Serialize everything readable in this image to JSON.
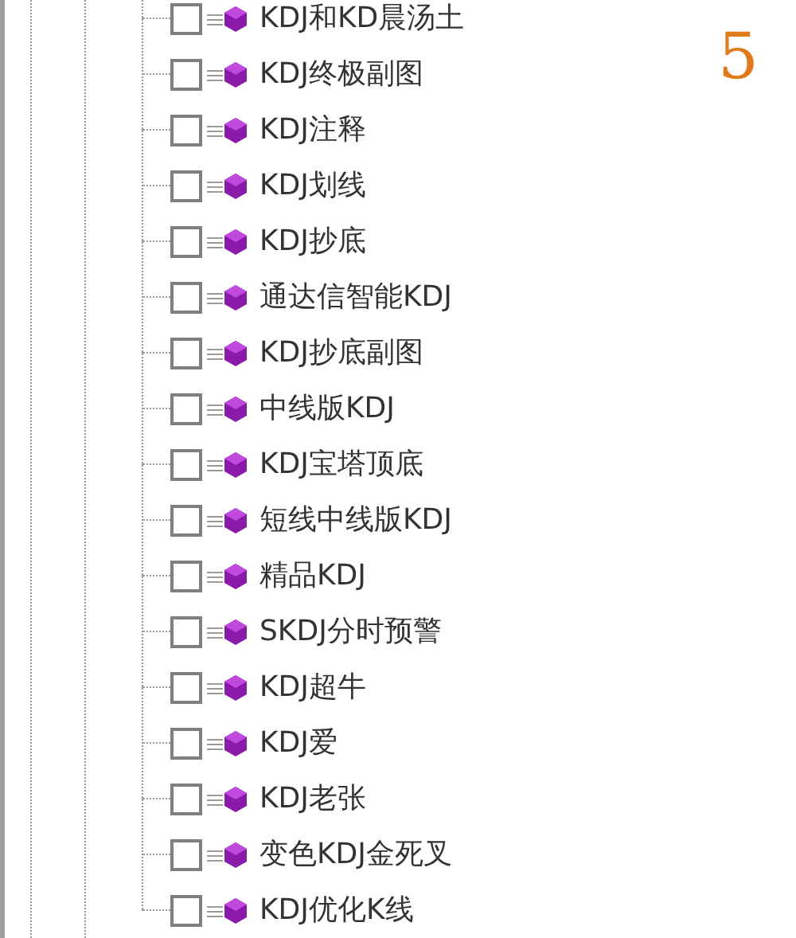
{
  "page_number": "5",
  "tree": {
    "items": [
      {
        "label": "KDJ和KD晨汤土",
        "checked": false
      },
      {
        "label": "KDJ终极副图",
        "checked": false
      },
      {
        "label": "KDJ注释",
        "checked": false
      },
      {
        "label": "KDJ划线",
        "checked": false
      },
      {
        "label": "KDJ抄底",
        "checked": false
      },
      {
        "label": "通达信智能KDJ",
        "checked": false
      },
      {
        "label": "KDJ抄底副图",
        "checked": false
      },
      {
        "label": "中线版KDJ",
        "checked": false
      },
      {
        "label": "KDJ宝塔顶底",
        "checked": false
      },
      {
        "label": "短线中线版KDJ",
        "checked": false
      },
      {
        "label": "精品KDJ",
        "checked": false
      },
      {
        "label": "SKDJ分时预警",
        "checked": false
      },
      {
        "label": "KDJ超牛",
        "checked": false
      },
      {
        "label": "KDJ爱",
        "checked": false
      },
      {
        "label": "KDJ老张",
        "checked": false
      },
      {
        "label": "变色KDJ金死叉",
        "checked": false
      },
      {
        "label": "KDJ优化K线",
        "checked": false
      }
    ]
  }
}
